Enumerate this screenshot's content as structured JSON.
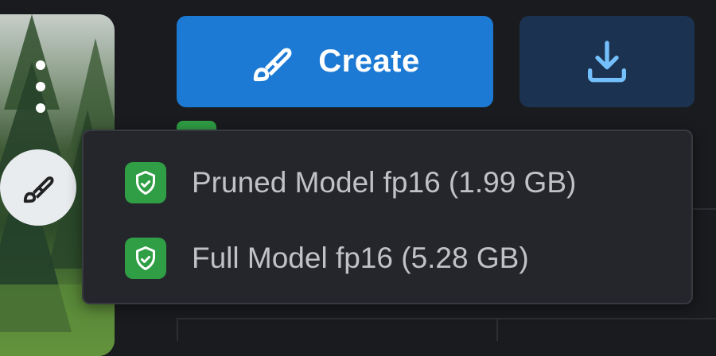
{
  "create_button": {
    "label": "Create",
    "color": "#1c7ad4"
  },
  "download_button": {
    "icon": "download-icon",
    "color": "#1b3350"
  },
  "thumbnail": {
    "menu_icon": "kebab-menu-icon",
    "action_icon": "brush-icon"
  },
  "download_menu": {
    "items": [
      {
        "label": "Pruned Model fp16 (1.99 GB)",
        "icon": "shield-check-icon"
      },
      {
        "label": "Full Model fp16 (5.28 GB)",
        "icon": "shield-check-icon"
      }
    ],
    "badge_color": "#2f9e44"
  }
}
